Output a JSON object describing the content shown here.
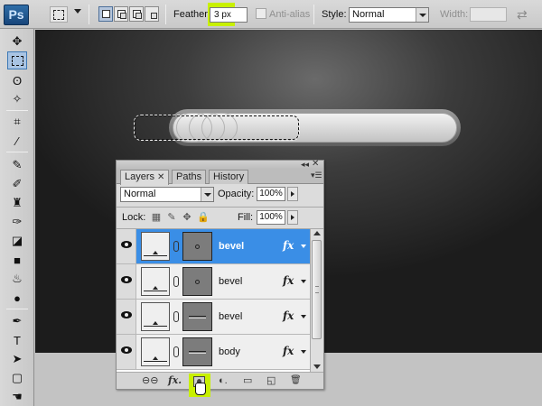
{
  "app": {
    "logo": "Ps"
  },
  "options_bar": {
    "feather_label": "Feather:",
    "feather_value": "3 px",
    "antialias_label": "Anti-alias",
    "style_label": "Style:",
    "style_value": "Normal",
    "width_label": "Width:",
    "swap_icon": "⇄"
  },
  "toolbox": {
    "tools": [
      "move-tool",
      "rectangular-marquee-tool",
      "lasso-tool",
      "magic-wand-tool",
      "crop-tool",
      "eyedropper-tool",
      "healing-brush-tool",
      "brush-tool",
      "clone-stamp-tool",
      "history-brush-tool",
      "eraser-tool",
      "gradient-tool",
      "blur-tool",
      "dodge-tool",
      "pen-tool",
      "type-tool",
      "path-selection-tool",
      "rectangle-tool"
    ]
  },
  "layers_panel": {
    "tabs": [
      {
        "label": "Layers",
        "active": true
      },
      {
        "label": "Paths",
        "active": false
      },
      {
        "label": "History",
        "active": false
      }
    ],
    "blend_mode": "Normal",
    "opacity_label": "Opacity:",
    "opacity_value": "100%",
    "lock_label": "Lock:",
    "fill_label": "Fill:",
    "fill_value": "100%",
    "fx_label": "fx",
    "layers": [
      {
        "name": "bevel",
        "selected": true,
        "mask": "dot"
      },
      {
        "name": "bevel",
        "selected": false,
        "mask": "dot"
      },
      {
        "name": "bevel",
        "selected": false,
        "mask": "line"
      },
      {
        "name": "body",
        "selected": false,
        "mask": "line"
      }
    ],
    "footer": {
      "link": "⊖⊖",
      "fx": "fx.",
      "adjust": "◐.",
      "group": "▭",
      "new": "◱",
      "trash": "🗑"
    }
  },
  "colors": {
    "selection": "#3a8ee6",
    "highlight": "#c8f000"
  }
}
